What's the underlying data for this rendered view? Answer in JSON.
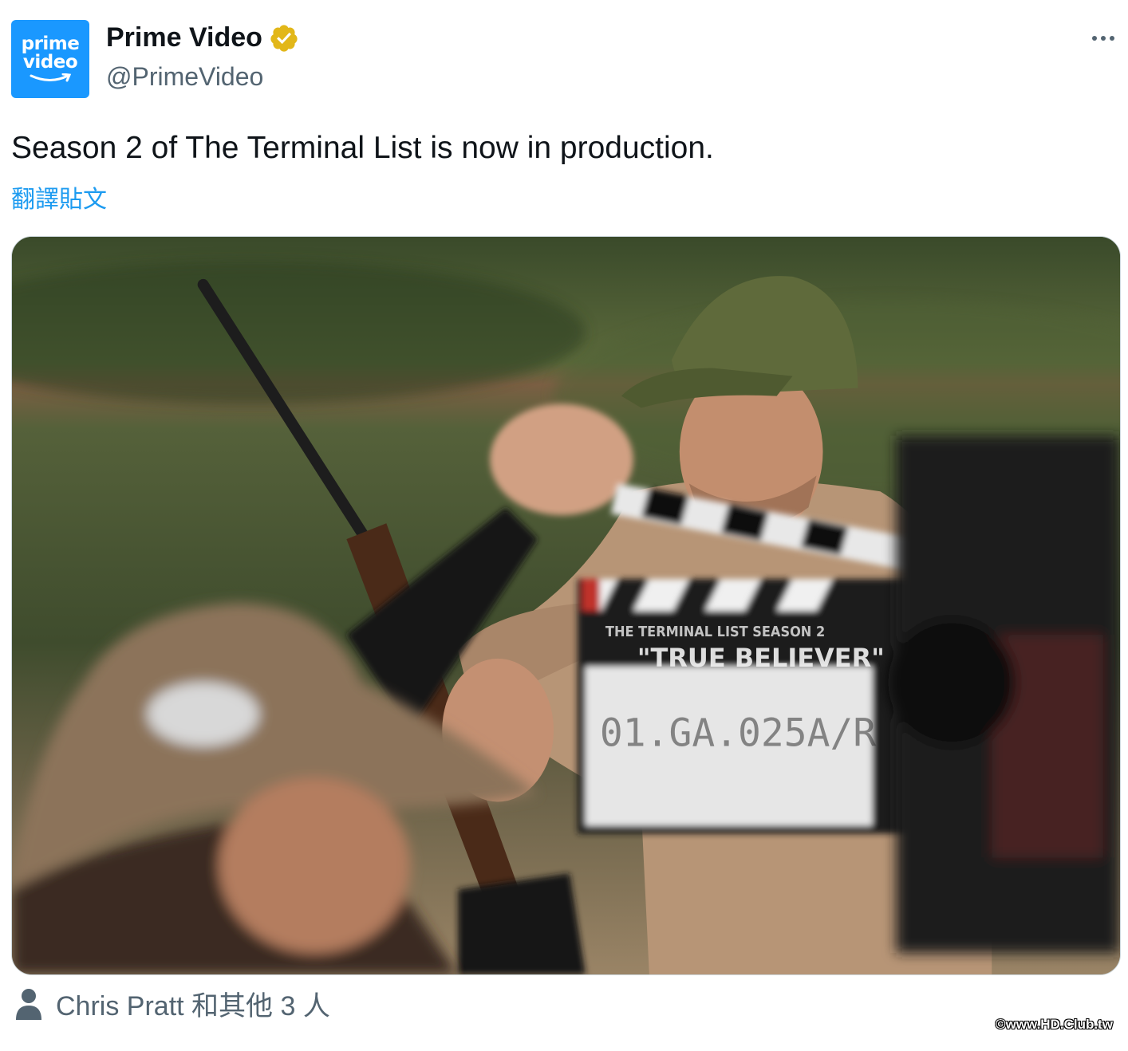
{
  "author": {
    "avatar_line1": "prime",
    "avatar_line2": "video",
    "display_name": "Prime Video",
    "handle": "@PrimeVideo",
    "verified_icon": "verified-badge-gold"
  },
  "menu": {
    "more_icon": "more-horizontal-icon"
  },
  "tweet": {
    "text": "Season 2 of The Terminal List is now in production.",
    "translate_label": "翻譯貼文"
  },
  "media": {
    "slate_line1": "THE TERMINAL LIST SEASON 2",
    "slate_line2": "\"TRUE BELIEVER\"",
    "slate_scene": "01.GA.025A/R"
  },
  "tags": {
    "icon": "person-icon",
    "text": "Chris Pratt 和其他 3 人"
  },
  "watermark": "©www.HD.Club.tw",
  "colors": {
    "brand_blue": "#1a98ff",
    "link_blue": "#1d9bf0",
    "secondary_text": "#536471",
    "verified_gold": "#e2b719"
  }
}
